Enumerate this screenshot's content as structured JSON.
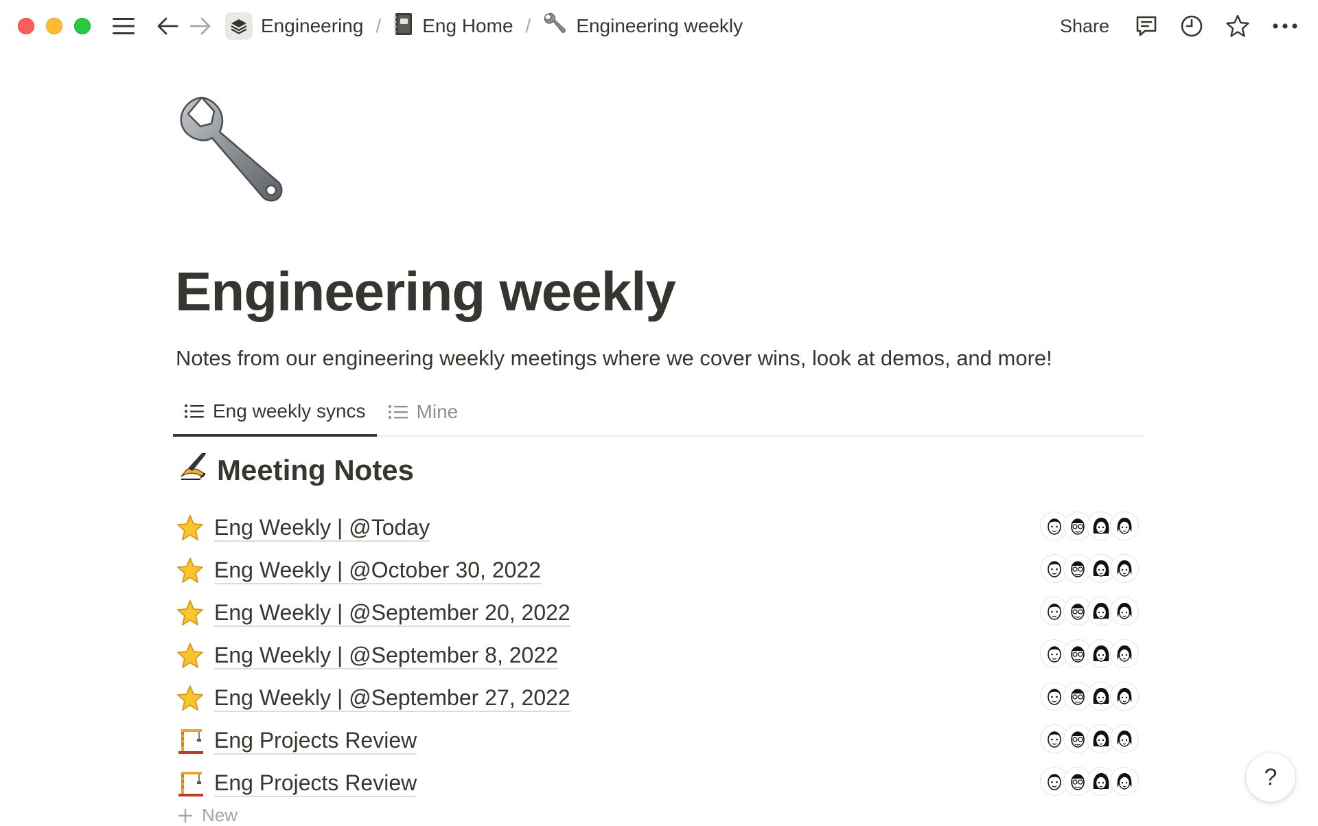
{
  "window": {
    "controls": [
      "close",
      "minimize",
      "zoom"
    ]
  },
  "breadcrumb": [
    {
      "label": "Engineering",
      "icon": "stack-icon"
    },
    {
      "label": "Eng Home",
      "icon": "notebook-icon"
    },
    {
      "label": "Engineering weekly",
      "icon": "wrench-icon"
    }
  ],
  "breadcrumb_separator": "/",
  "toolbar": {
    "share_label": "Share"
  },
  "page": {
    "icon": "wrench-icon",
    "title": "Engineering weekly",
    "description": "Notes from our engineering weekly meetings where we cover wins, look at demos, and more!"
  },
  "tabs": [
    {
      "label": "Eng weekly syncs",
      "active": true
    },
    {
      "label": "Mine",
      "active": false
    }
  ],
  "section": {
    "icon": "writing-hand-icon",
    "title": "Meeting Notes"
  },
  "rows": [
    {
      "icon": "star-icon",
      "title": "Eng Weekly | @Today"
    },
    {
      "icon": "star-icon",
      "title": "Eng Weekly | @October 30, 2022"
    },
    {
      "icon": "star-icon",
      "title": "Eng Weekly | @September 20, 2022"
    },
    {
      "icon": "star-icon",
      "title": "Eng Weekly | @September 8, 2022"
    },
    {
      "icon": "star-icon",
      "title": "Eng Weekly | @September 27, 2022"
    },
    {
      "icon": "construction-icon",
      "title": "Eng Projects Review"
    },
    {
      "icon": "construction-icon",
      "title": "Eng Projects Review"
    }
  ],
  "new_label": "New",
  "help_label": "?",
  "colors": {
    "text": "#37352f",
    "muted": "#8f8e89",
    "divider": "#e9e9e7",
    "star": "#f5c518",
    "traffic_red": "#ff5f57",
    "traffic_yellow": "#febc2e",
    "traffic_green": "#28c840"
  }
}
